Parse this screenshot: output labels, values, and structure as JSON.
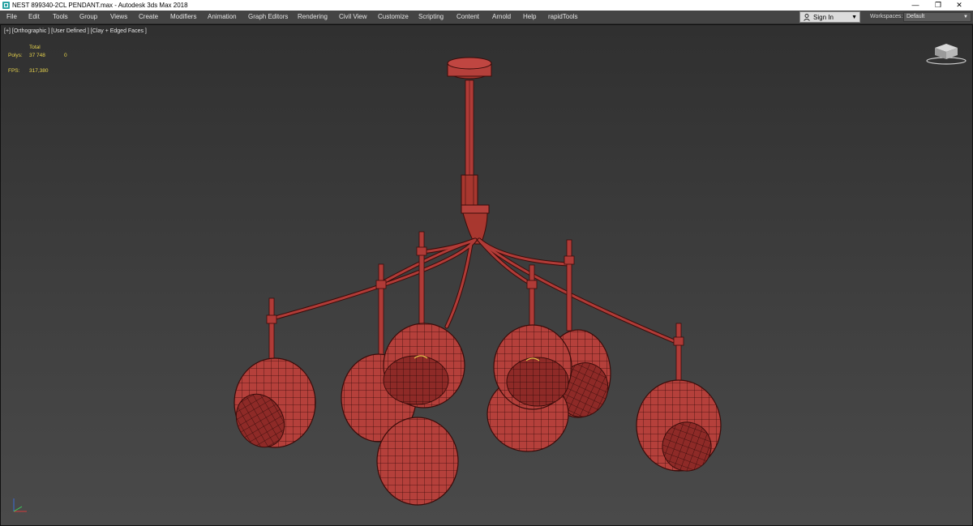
{
  "window": {
    "title": "NEST 899340-2CL PENDANT.max - Autodesk 3ds Max 2018",
    "controls": {
      "minimize": "—",
      "maximize": "❐",
      "close": "✕"
    }
  },
  "menu": {
    "items": [
      "File",
      "Edit",
      "Tools",
      "Group",
      "Views",
      "Create",
      "Modifiers",
      "Animation",
      "Graph Editors",
      "Rendering",
      "Civil View",
      "Customize",
      "Scripting",
      "Content",
      "Arnold",
      "Help",
      "rapidTools"
    ],
    "sign_in": "Sign In",
    "workspaces_label": "Workspaces:",
    "workspace_value": "Default"
  },
  "viewport": {
    "label": "[+] [Orthographic ] [User Defined ] [Clay + Edged Faces ]",
    "stats": {
      "total_label": "Total",
      "polys_label": "Polys:",
      "polys_value": "37 748",
      "polys_selected": "0",
      "fps_label": "FPS:",
      "fps_value": "317,380"
    }
  },
  "colors": {
    "model": "#b23a36",
    "wire": "#3a0c0a",
    "stats_text": "#e8d44d",
    "menubar": "#444444"
  }
}
